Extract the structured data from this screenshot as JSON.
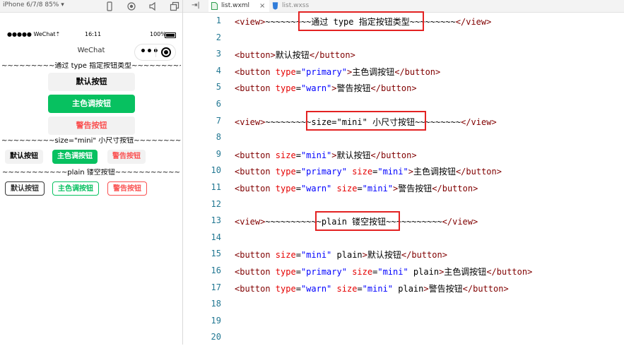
{
  "simulator": {
    "device_label": "iPhone 6/7/8 85% ▾",
    "status_bar": {
      "carrier": "●●●●● WeChat⇡",
      "time": "16:11",
      "battery": "100%"
    },
    "nav_title": "WeChat",
    "capsule_dots": "•••",
    "view_lines": [
      "~~~~~~~~~通过 type 指定按钮类型~~~~~~~~~",
      "~~~~~~~~~size=\"mini\" 小尺寸按钮~~~~~~~~~",
      "~~~~~~~~~~~plain 镂空按钮~~~~~~~~~~~"
    ],
    "buttons_default": [
      "默认按钮",
      "主色调按钮",
      "警告按钮"
    ],
    "buttons_mini": [
      "默认按钮",
      "主色调按钮",
      "警告按钮"
    ],
    "buttons_plain": [
      "默认按钮",
      "主色调按钮",
      "警告按钮"
    ]
  },
  "editor": {
    "collapse_icon": "⇥|",
    "tabs": [
      {
        "label": "list.wxml",
        "close": "×",
        "active": true
      },
      {
        "label": "list.wxss",
        "active": false
      }
    ],
    "line_numbers": [
      "1",
      "2",
      "3",
      "4",
      "5",
      "6",
      "7",
      "8",
      "9",
      "10",
      "11",
      "12",
      "13",
      "14",
      "15",
      "16",
      "17",
      "18",
      "19",
      "20"
    ],
    "lines": [
      [
        [
          "tag",
          "<view>"
        ],
        [
          "txt",
          "~~~~~~~~~通过 type 指定按钮类型~~~~~~~~~"
        ],
        [
          "tag",
          "</view>"
        ]
      ],
      [],
      [
        [
          "tag",
          "<button>"
        ],
        [
          "txt",
          "默认按钮"
        ],
        [
          "tag",
          "</button>"
        ]
      ],
      [
        [
          "tag",
          "<button "
        ],
        [
          "attr",
          "type"
        ],
        [
          "txt",
          "="
        ],
        [
          "str",
          "\"primary\""
        ],
        [
          "tag",
          ">"
        ],
        [
          "txt",
          "主色调按钮"
        ],
        [
          "tag",
          "</button>"
        ]
      ],
      [
        [
          "tag",
          "<button "
        ],
        [
          "attr",
          "type"
        ],
        [
          "txt",
          "="
        ],
        [
          "str",
          "\"warn\""
        ],
        [
          "tag",
          ">"
        ],
        [
          "txt",
          "警告按钮"
        ],
        [
          "tag",
          "</button>"
        ]
      ],
      [],
      [
        [
          "tag",
          "<view>"
        ],
        [
          "txt",
          "~~~~~~~~~size=\"mini\" 小尺寸按钮~~~~~~~~~"
        ],
        [
          "tag",
          "</view>"
        ]
      ],
      [],
      [
        [
          "tag",
          "<button "
        ],
        [
          "attr",
          "size"
        ],
        [
          "txt",
          "="
        ],
        [
          "str",
          "\"mini\""
        ],
        [
          "tag",
          ">"
        ],
        [
          "txt",
          "默认按钮"
        ],
        [
          "tag",
          "</button>"
        ]
      ],
      [
        [
          "tag",
          "<button "
        ],
        [
          "attr",
          "type"
        ],
        [
          "txt",
          "="
        ],
        [
          "str",
          "\"primary\""
        ],
        [
          "txt",
          " "
        ],
        [
          "attr",
          "size"
        ],
        [
          "txt",
          "="
        ],
        [
          "str",
          "\"mini\""
        ],
        [
          "tag",
          ">"
        ],
        [
          "txt",
          "主色调按钮"
        ],
        [
          "tag",
          "</button>"
        ]
      ],
      [
        [
          "tag",
          "<button "
        ],
        [
          "attr",
          "type"
        ],
        [
          "txt",
          "="
        ],
        [
          "str",
          "\"warn\""
        ],
        [
          "txt",
          " "
        ],
        [
          "attr",
          "size"
        ],
        [
          "txt",
          "="
        ],
        [
          "str",
          "\"mini\""
        ],
        [
          "tag",
          ">"
        ],
        [
          "txt",
          "警告按钮"
        ],
        [
          "tag",
          "</button>"
        ]
      ],
      [],
      [
        [
          "tag",
          "<view>"
        ],
        [
          "txt",
          "~~~~~~~~~~~plain 镂空按钮~~~~~~~~~~~"
        ],
        [
          "tag",
          "</view>"
        ]
      ],
      [],
      [
        [
          "tag",
          "<button "
        ],
        [
          "attr",
          "size"
        ],
        [
          "txt",
          "="
        ],
        [
          "str",
          "\"mini\""
        ],
        [
          "txt",
          " plain"
        ],
        [
          "tag",
          ">"
        ],
        [
          "txt",
          "默认按钮"
        ],
        [
          "tag",
          "</button>"
        ]
      ],
      [
        [
          "tag",
          "<button "
        ],
        [
          "attr",
          "type"
        ],
        [
          "txt",
          "="
        ],
        [
          "str",
          "\"primary\""
        ],
        [
          "txt",
          " "
        ],
        [
          "attr",
          "size"
        ],
        [
          "txt",
          "="
        ],
        [
          "str",
          "\"mini\""
        ],
        [
          "txt",
          " plain"
        ],
        [
          "tag",
          ">"
        ],
        [
          "txt",
          "主色调按钮"
        ],
        [
          "tag",
          "</button>"
        ]
      ],
      [
        [
          "tag",
          "<button "
        ],
        [
          "attr",
          "type"
        ],
        [
          "txt",
          "="
        ],
        [
          "str",
          "\"warn\""
        ],
        [
          "txt",
          " "
        ],
        [
          "attr",
          "size"
        ],
        [
          "txt",
          "="
        ],
        [
          "str",
          "\"mini\""
        ],
        [
          "txt",
          " plain"
        ],
        [
          "tag",
          ">"
        ],
        [
          "txt",
          "警告按钮"
        ],
        [
          "tag",
          "</button>"
        ]
      ],
      [],
      [],
      []
    ]
  },
  "colors": {
    "primary_green": "#07c160",
    "warn_red": "#fa5151",
    "highlight_red": "#e32222",
    "tag": "#800000",
    "attr": "#e50000",
    "string": "#0000ff",
    "line_number": "#237893"
  }
}
